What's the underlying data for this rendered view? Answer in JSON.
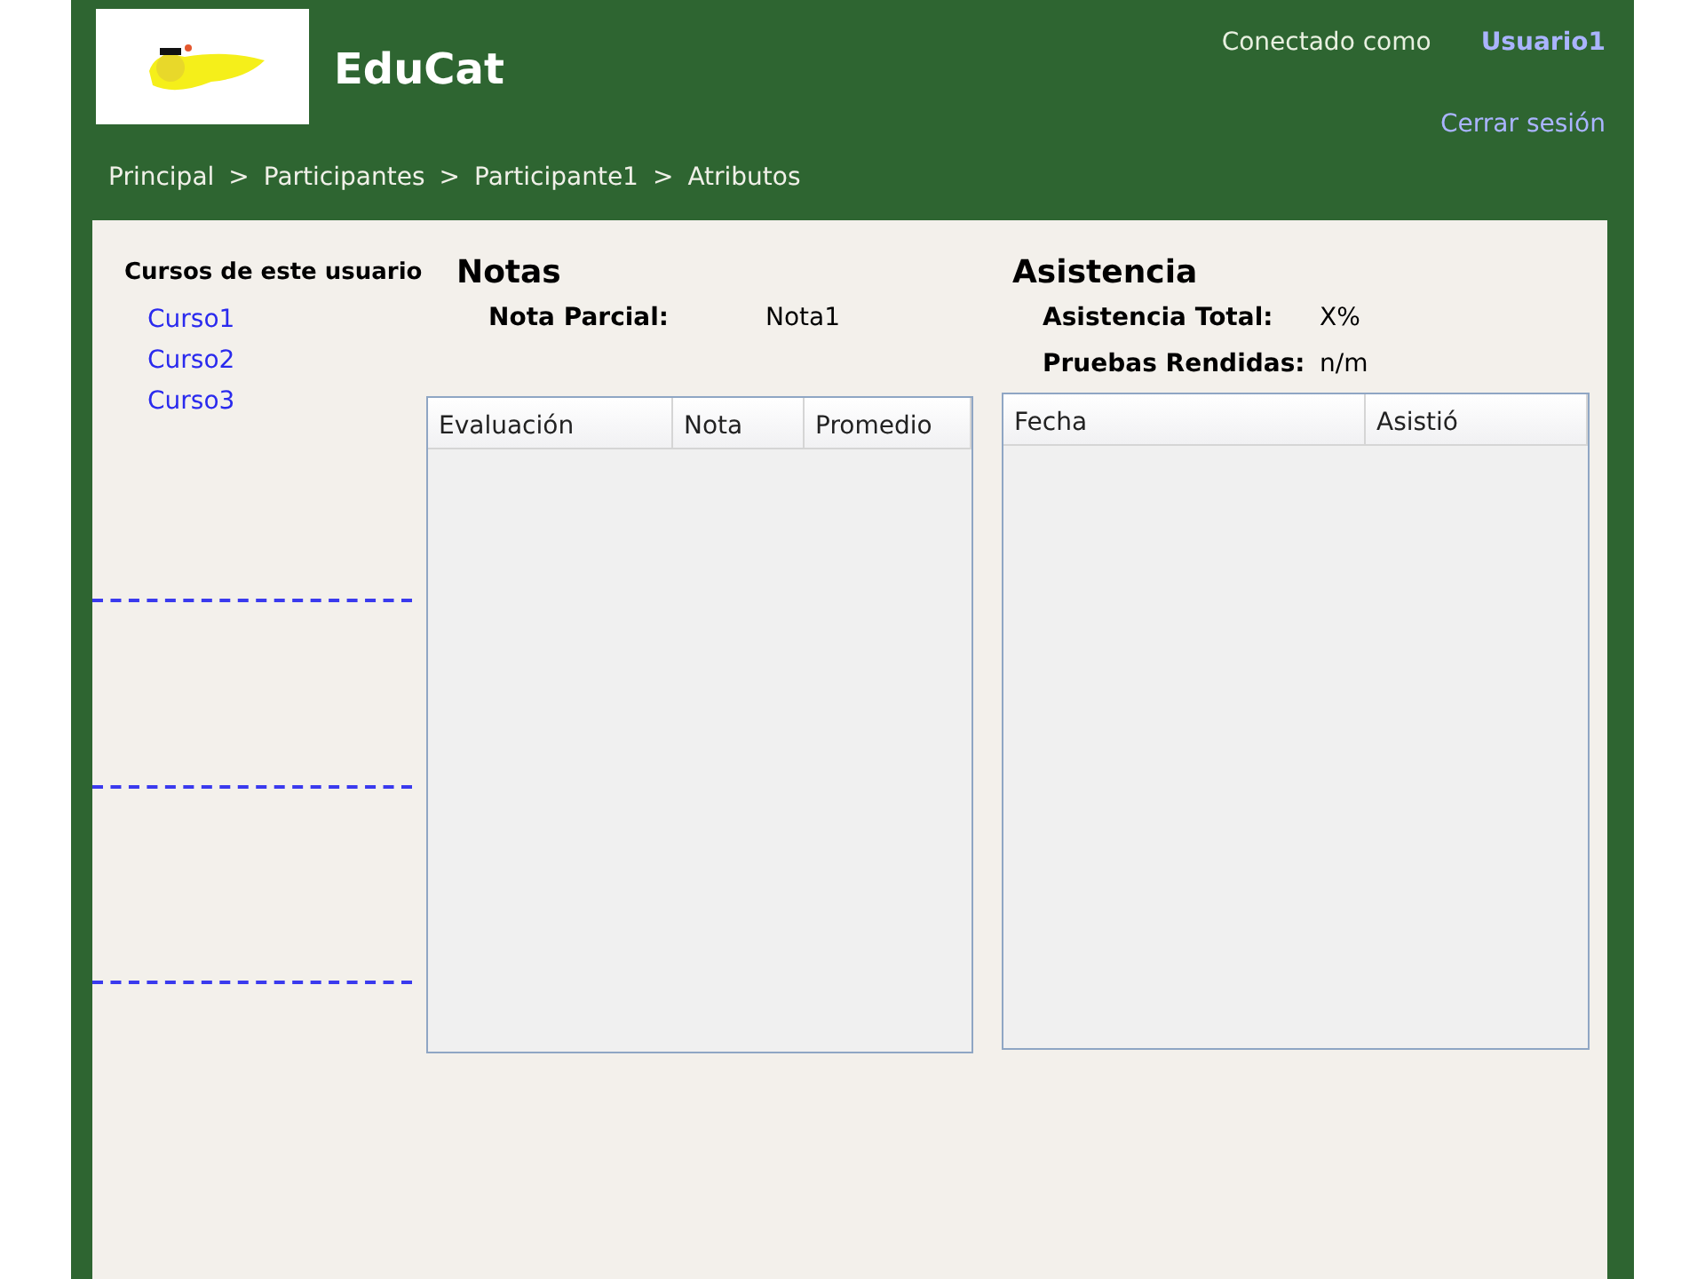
{
  "header": {
    "title": "EduCat",
    "connected_label": "Conectado como",
    "user": "Usuario1",
    "logout": "Cerrar sesión"
  },
  "breadcrumb": {
    "items": [
      "Principal",
      "Participantes",
      "Participante1",
      "Atributos"
    ],
    "separators": [
      ">",
      ">",
      ">"
    ]
  },
  "courses": {
    "title": "Cursos de este usuario",
    "items": [
      "Curso1",
      "Curso2",
      "Curso3"
    ]
  },
  "notas": {
    "title": "Notas",
    "fields": [
      {
        "label": "Nota Parcial:",
        "value": "Nota1"
      }
    ],
    "table": {
      "columns": [
        "Evaluación",
        "Nota",
        "Promedio"
      ]
    }
  },
  "asistencia": {
    "title": "Asistencia",
    "fields": [
      {
        "label": "Asistencia Total:",
        "value": "X%"
      },
      {
        "label": "Pruebas Rendidas:",
        "value": "n/m"
      }
    ],
    "table": {
      "columns": [
        "Fecha",
        "Asistió"
      ]
    }
  }
}
